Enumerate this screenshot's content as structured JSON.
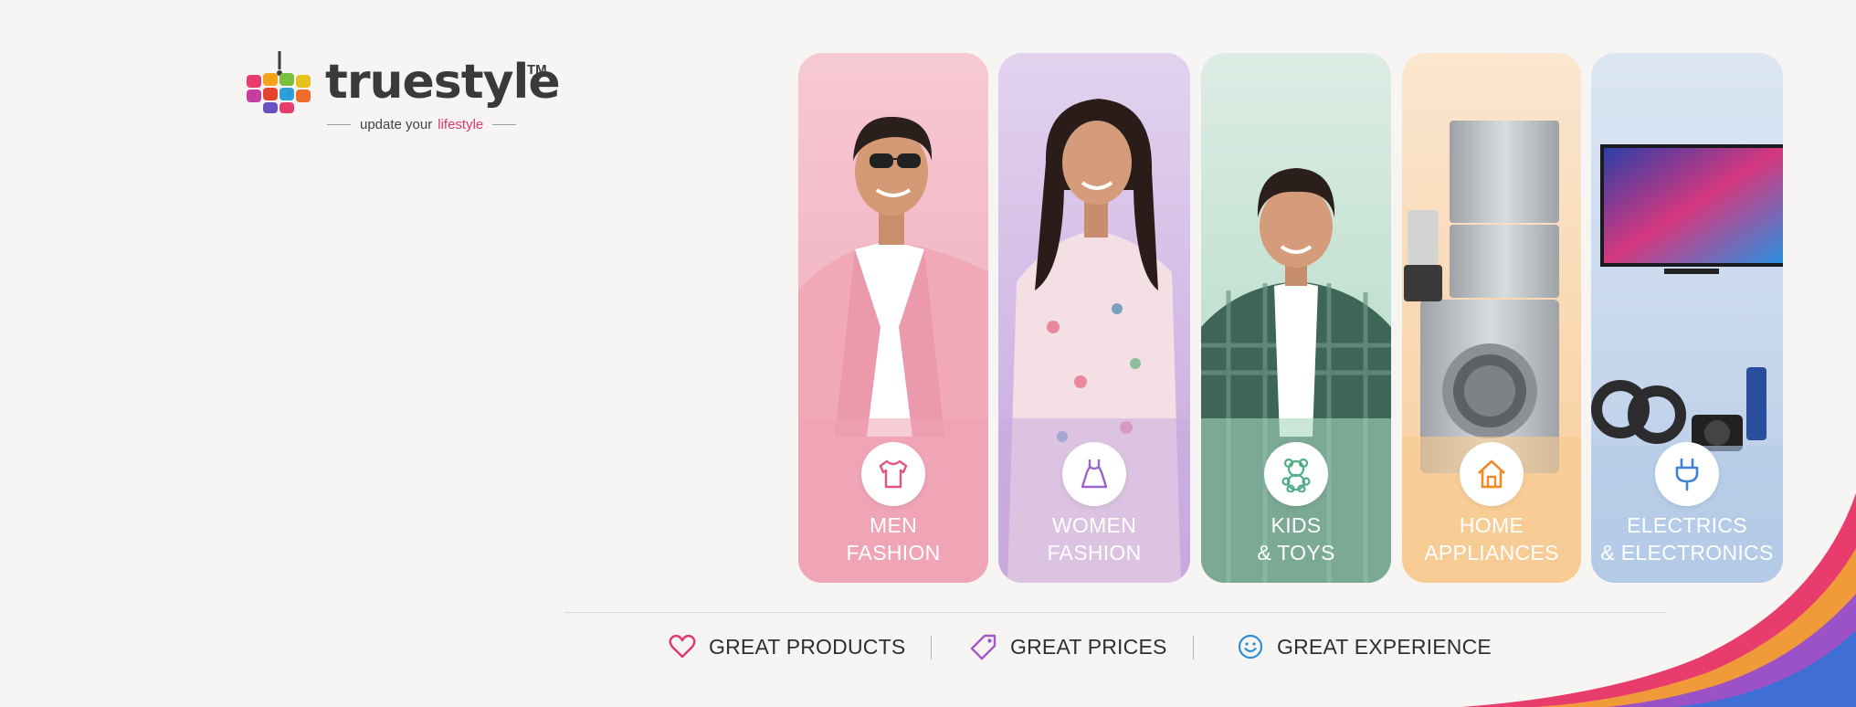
{
  "brand": {
    "name": "truestyle",
    "trademark": "TM",
    "tagline_prefix": "update your",
    "tagline_accent": "lifestyle"
  },
  "categories": [
    {
      "line1": "MEN",
      "line2": "FASHION",
      "icon": "tshirt-icon",
      "color": "#e0567e"
    },
    {
      "line1": "WOMEN",
      "line2": "FASHION",
      "icon": "dress-icon",
      "color": "#9a64c9"
    },
    {
      "line1": "KIDS",
      "line2": "& TOYS",
      "icon": "teddy-bear-icon",
      "color": "#4fae86"
    },
    {
      "line1": "HOME",
      "line2": "APPLIANCES",
      "icon": "house-icon",
      "color": "#ef8a24"
    },
    {
      "line1": "ELECTRICS",
      "line2": "& ELECTRONICS",
      "icon": "plug-icon",
      "color": "#3f82d4"
    }
  ],
  "benefits": [
    {
      "label": "GREAT PRODUCTS",
      "icon": "heart-icon",
      "color": "#e0356e"
    },
    {
      "label": "GREAT PRICES",
      "icon": "price-tag-icon",
      "color": "#a457c9"
    },
    {
      "label": "GREAT EXPERIENCE",
      "icon": "smiley-icon",
      "color": "#2e8fd6"
    }
  ]
}
